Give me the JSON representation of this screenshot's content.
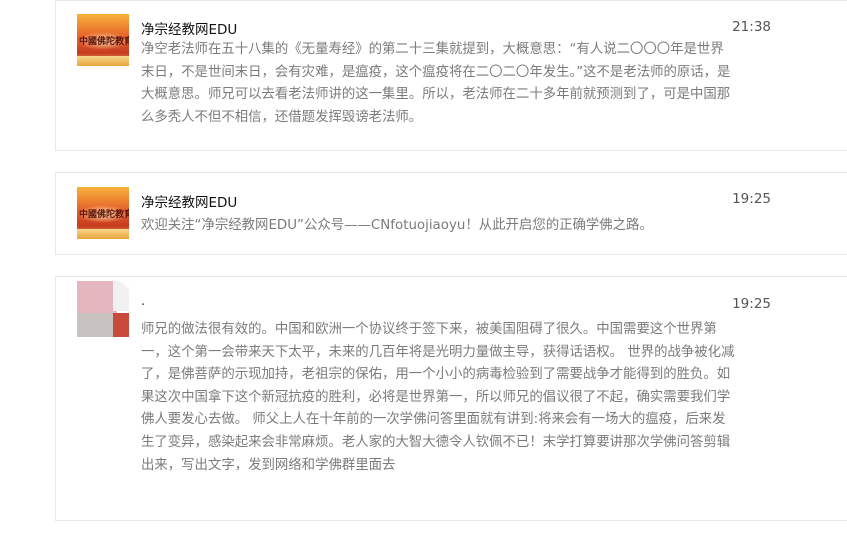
{
  "messages": [
    {
      "name": "净宗经教网EDU",
      "time": "21:38",
      "avatar_text": "中國佛陀教育",
      "text": "净空老法师在五十八集的《无量寿经》的第二十三集就提到，大概意思：“有人说二〇〇〇年是世界末日，不是世间末日，会有灾难，是瘟疫，这个瘟疫将在二〇二〇年发生。”这不是老法师的原话，是大概意思。师兄可以去看老法师讲的这一集里。所以，老法师在二十多年前就预测到了，可是中国那么多秃人不但不相信，还借题发挥毁谤老法师。"
    },
    {
      "name": "净宗经教网EDU",
      "time": "19:25",
      "avatar_text": "中國佛陀教育",
      "text": "欢迎关注“净宗经教网EDU”公众号——CNfotuojiaoyu！从此开启您的正确学佛之路。"
    },
    {
      "name": ".",
      "time": "19:25",
      "text": "师兄的做法很有效的。中国和欧洲一个协议终于签下来，被美国阻碍了很久。中国需要这个世界第一，这个第一会带来天下太平，未来的几百年将是光明力量做主导，获得话语权。 世界的战争被化减了，是佛菩萨的示现加持，老祖宗的保佑，用一个小小的病毒检验到了需要战争才能得到的胜负。如果这次中国拿下这个新冠抗疫的胜利，必将是世界第一，所以师兄的倡议很了不起，确实需要我们学佛人要发心去做。 师父上人在十年前的一次学佛问答里面就有讲到:将来会有一场大的瘟疫，后来发生了变异，感染起来会非常麻烦。老人家的大智大德令人钦佩不已！末学打算要讲那次学佛问答剪辑出来，写出文字，发到网络和学佛群里面去"
    }
  ]
}
